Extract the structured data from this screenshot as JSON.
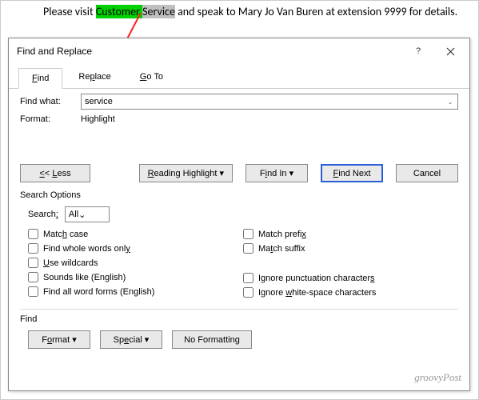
{
  "doc": {
    "pre": "Please visit ",
    "highlight_a": "Customer ",
    "highlight_b": "Service",
    "post": " and speak to Mary Jo Van Buren at extension 9999 for details."
  },
  "dialog": {
    "title": "Find and Replace",
    "tabs": {
      "find": "Find",
      "replace": "Replace",
      "goto": "Go To"
    },
    "find_what_label": "Find what:",
    "find_what_value": "service",
    "format_label": "Format:",
    "format_value": "Highlight",
    "buttons": {
      "less": "<< Less",
      "reading": "Reading Highlight",
      "findin": "Find In",
      "findnext": "Find Next",
      "cancel": "Cancel",
      "format": "Format",
      "special": "Special",
      "noformat": "No Formatting"
    },
    "search_options_label": "Search Options",
    "search_label": "Search:",
    "search_value": "All",
    "checks": {
      "matchcase": "Match case",
      "wholewords": "Find whole words only",
      "wildcards": "Use wildcards",
      "soundslike": "Sounds like (English)",
      "wordforms": "Find all word forms (English)",
      "prefix": "Match prefix",
      "suffix": "Match suffix",
      "ignorepunct": "Ignore punctuation characters",
      "ignorews": "Ignore white-space characters"
    },
    "find_section_label": "Find"
  },
  "watermark": "groovyPost"
}
